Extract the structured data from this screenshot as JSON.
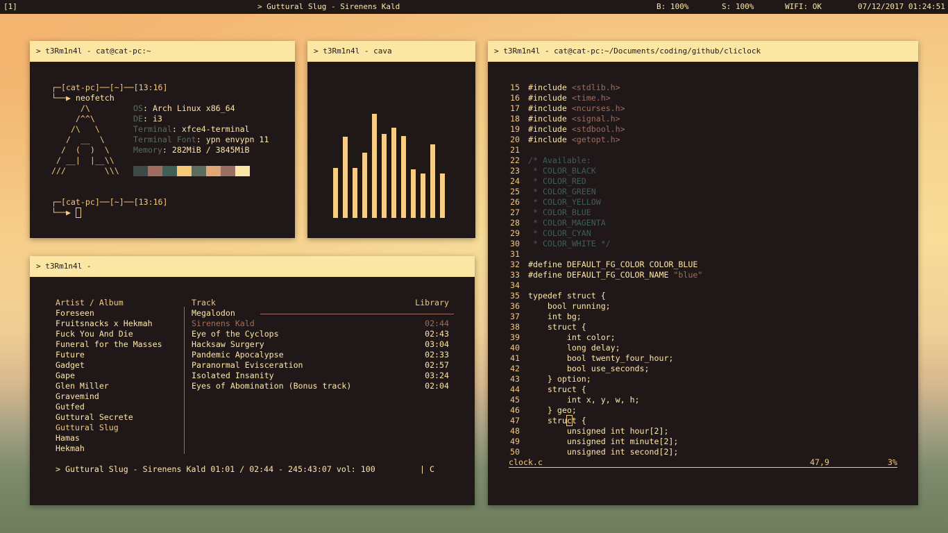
{
  "topbar": {
    "workspace": "[1]",
    "now_playing": "> Guttural Slug - Sirenens Kald",
    "battery": "B: 100%",
    "sound": "S: 100%",
    "wifi": "WIFI: OK",
    "datetime": "07/12/2017 01:24:51 PM"
  },
  "windows": {
    "neofetch": {
      "title": "> t3Rm1n4l - cat@cat-pc:~",
      "prompt1": "┌─[cat-pc]──[~]──[13:16]",
      "cmd_arrow": "└──▶ ",
      "cmd": "neofetch",
      "ascii": [
        "      /\\",
        "     /^^\\",
        "    /\\   \\",
        "   /  __  \\",
        "  /  (  )  \\",
        " / __|  |__\\\\",
        "///        \\\\\\"
      ],
      "info": [
        {
          "k": "OS",
          "v": "Arch Linux x86_64"
        },
        {
          "k": "DE",
          "v": "i3"
        },
        {
          "k": "Terminal",
          "v": "xfce4-terminal"
        },
        {
          "k": "Terminal Font",
          "v": "ypn envypn 11"
        },
        {
          "k": "Memory",
          "v": "282MiB / 3845MiB"
        }
      ],
      "palette": [
        "#3e4844",
        "#a06c5f",
        "#3f5e55",
        "#f5c97a",
        "#5b6b5e",
        "#e0a676",
        "#9c6f64",
        "#fde7a6"
      ],
      "prompt2": "┌─[cat-pc]──[~]──[13:16]",
      "prompt2_arrow": "└──▶ "
    },
    "cava": {
      "title": "> t3Rm1n4l - cava",
      "levels_percent": [
        48,
        78,
        48,
        63,
        100,
        81,
        87,
        79,
        47,
        43,
        71,
        43
      ],
      "bar_color": "#f6cd82"
    },
    "cmus": {
      "title": "> t3Rm1n4l -",
      "artist_header": "Artist / Album",
      "track_header": "Track",
      "library_label": "Library",
      "album": "Megalodon",
      "artists": [
        "Foreseen",
        "Fruitsnacks x Hekmah",
        "Fuck You And Die",
        "Funeral for the Masses",
        "Future",
        "Gadget",
        "Gape",
        "Glen Miller",
        "Gravemind",
        "Gutfed",
        "Guttural Secrete",
        "Guttural Slug",
        "Hamas",
        "Hekmah"
      ],
      "selected_artist": "Guttural Slug",
      "tracks": [
        {
          "name": "Sirenens Kald",
          "len": "02:44",
          "playing": true
        },
        {
          "name": "Eye of the Cyclops",
          "len": "02:43"
        },
        {
          "name": "Hacksaw Surgery",
          "len": "03:04"
        },
        {
          "name": "Pandemic Apocalypse",
          "len": "02:33"
        },
        {
          "name": "Paranormal Evisceration",
          "len": "02:57"
        },
        {
          "name": "Isolated Insanity",
          "len": "03:24"
        },
        {
          "name": "Eyes of Abomination (Bonus track)",
          "len": "02:04"
        }
      ],
      "status": "> Guttural Slug - Sirenens Kald 01:01 / 02:44 - 245:43:07 vol: 100",
      "status_flags": "| C"
    },
    "vim": {
      "title": "> t3Rm1n4l - cat@cat-pc:~/Documents/coding/github/cliclock",
      "lines": [
        {
          "n": "15",
          "p": [
            [
              "#include ",
              "fg"
            ],
            [
              "<stdlib.h>",
              "str"
            ]
          ]
        },
        {
          "n": "16",
          "p": [
            [
              "#include ",
              "fg"
            ],
            [
              "<time.h>",
              "str"
            ]
          ]
        },
        {
          "n": "17",
          "p": [
            [
              "#include ",
              "fg"
            ],
            [
              "<ncurses.h>",
              "str"
            ]
          ]
        },
        {
          "n": "18",
          "p": [
            [
              "#include ",
              "fg"
            ],
            [
              "<signal.h>",
              "str"
            ]
          ]
        },
        {
          "n": "19",
          "p": [
            [
              "#include ",
              "fg"
            ],
            [
              "<stdbool.h>",
              "str"
            ]
          ]
        },
        {
          "n": "20",
          "p": [
            [
              "#include ",
              "fg"
            ],
            [
              "<getopt.h>",
              "str"
            ]
          ]
        },
        {
          "n": "21",
          "p": []
        },
        {
          "n": "22",
          "p": [
            [
              "/* Available:",
              "cm"
            ]
          ]
        },
        {
          "n": "23",
          "p": [
            [
              " * COLOR_BLACK",
              "cm"
            ]
          ]
        },
        {
          "n": "24",
          "p": [
            [
              " * COLOR_RED",
              "cm"
            ]
          ]
        },
        {
          "n": "25",
          "p": [
            [
              " * COLOR_GREEN",
              "cm"
            ]
          ]
        },
        {
          "n": "26",
          "p": [
            [
              " * COLOR_YELLOW",
              "cm"
            ]
          ]
        },
        {
          "n": "27",
          "p": [
            [
              " * COLOR_BLUE",
              "cm"
            ]
          ]
        },
        {
          "n": "28",
          "p": [
            [
              " * COLOR_MAGENTA",
              "cm"
            ]
          ]
        },
        {
          "n": "29",
          "p": [
            [
              " * COLOR_CYAN",
              "cm"
            ]
          ]
        },
        {
          "n": "30",
          "p": [
            [
              " * COLOR_WHITE */",
              "cm"
            ]
          ]
        },
        {
          "n": "31",
          "p": []
        },
        {
          "n": "32",
          "p": [
            [
              "#define DEFAULT_FG_COLOR COLOR_BLUE",
              "fg"
            ]
          ]
        },
        {
          "n": "33",
          "p": [
            [
              "#define DEFAULT_FG_COLOR_NAME ",
              "fg"
            ],
            [
              "\"blue\"",
              "str"
            ]
          ]
        },
        {
          "n": "34",
          "p": []
        },
        {
          "n": "35",
          "p": [
            [
              "typedef struct {",
              "fg"
            ]
          ]
        },
        {
          "n": "36",
          "p": [
            [
              "    bool running;",
              "fg"
            ]
          ]
        },
        {
          "n": "37",
          "p": [
            [
              "    int bg;",
              "fg"
            ]
          ]
        },
        {
          "n": "38",
          "p": [
            [
              "    struct {",
              "fg"
            ]
          ]
        },
        {
          "n": "39",
          "p": [
            [
              "        int color;",
              "fg"
            ]
          ]
        },
        {
          "n": "40",
          "p": [
            [
              "        long delay;",
              "fg"
            ]
          ]
        },
        {
          "n": "41",
          "p": [
            [
              "        bool twenty_four_hour;",
              "fg"
            ]
          ]
        },
        {
          "n": "42",
          "p": [
            [
              "        bool use_seconds;",
              "fg"
            ]
          ]
        },
        {
          "n": "43",
          "p": [
            [
              "    } option;",
              "fg"
            ]
          ]
        },
        {
          "n": "44",
          "p": [
            [
              "    struct {",
              "fg"
            ]
          ]
        },
        {
          "n": "45",
          "p": [
            [
              "        int x, y, w, h;",
              "fg"
            ]
          ]
        },
        {
          "n": "46",
          "p": [
            [
              "    } geo;",
              "fg"
            ]
          ]
        },
        {
          "n": "47",
          "p": [
            [
              "    stru",
              "fg"
            ],
            [
              "c",
              "cursor"
            ],
            [
              "t {",
              "fg"
            ]
          ]
        },
        {
          "n": "48",
          "p": [
            [
              "        unsigned int hour[2];",
              "fg"
            ]
          ]
        },
        {
          "n": "49",
          "p": [
            [
              "        unsigned int minute[2];",
              "fg"
            ]
          ]
        },
        {
          "n": "50",
          "p": [
            [
              "        unsigned int second[2];",
              "fg"
            ]
          ]
        }
      ],
      "statusline": {
        "file": "clock.c",
        "pos": "47,9",
        "percent": "3%"
      }
    }
  }
}
